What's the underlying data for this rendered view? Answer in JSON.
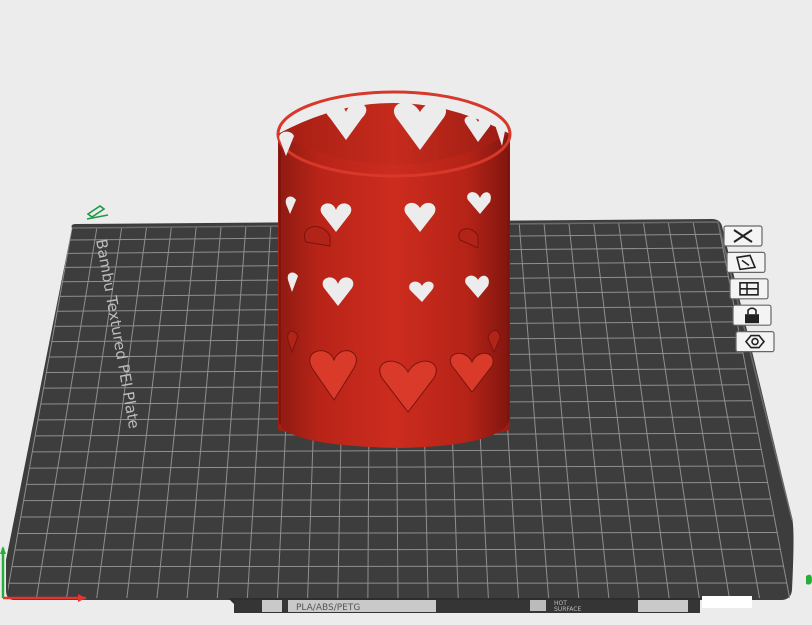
{
  "plate": {
    "brand_text": "Bambu Textured PEI Plate",
    "bottom_strip_code": "PLA/ABS/PETG",
    "bottom_strip_hot": "HOT",
    "bottom_strip_surface": "SURFACE"
  },
  "plate_toolbar": [
    {
      "name": "delete-plate-button",
      "icon": "close-icon"
    },
    {
      "name": "pick-plate-button",
      "icon": "pick-icon"
    },
    {
      "name": "arrange-plate-button",
      "icon": "arrange-icon"
    },
    {
      "name": "lock-plate-button",
      "icon": "lock-icon"
    },
    {
      "name": "plate-settings-button",
      "icon": "gear-icon"
    }
  ],
  "model": {
    "name": "heart-cylinder",
    "color": "#c0281c"
  },
  "colors": {
    "background": "#ececec",
    "plate": "#3d3d3d",
    "grid": "#8f8f8f",
    "model": "#c0281c",
    "model_dark": "#8e1a12",
    "model_light": "#dd3b2b"
  }
}
